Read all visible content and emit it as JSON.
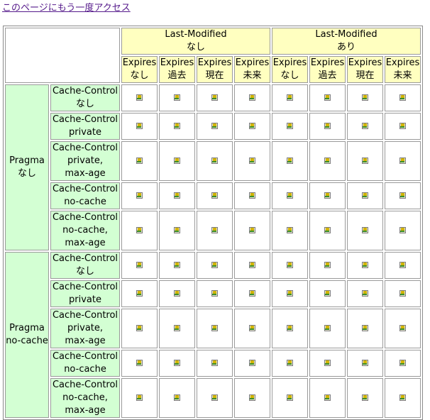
{
  "top_link": "このページにもう一度アクセス",
  "header": {
    "last_modified_groups": [
      {
        "line1": "Last-Modified",
        "line2": "なし"
      },
      {
        "line1": "Last-Modified",
        "line2": "あり"
      }
    ],
    "expires_columns": [
      {
        "line1": "Expires",
        "line2": "なし"
      },
      {
        "line1": "Expires",
        "line2": "過去"
      },
      {
        "line1": "Expires",
        "line2": "現在"
      },
      {
        "line1": "Expires",
        "line2": "未来"
      },
      {
        "line1": "Expires",
        "line2": "なし"
      },
      {
        "line1": "Expires",
        "line2": "過去"
      },
      {
        "line1": "Expires",
        "line2": "現在"
      },
      {
        "line1": "Expires",
        "line2": "未来"
      }
    ]
  },
  "pragma_groups": [
    {
      "label": [
        "Pragma",
        "なし"
      ],
      "cache_control_rows": [
        [
          "Cache-Control",
          "なし"
        ],
        [
          "Cache-Control",
          "private"
        ],
        [
          "Cache-Control",
          "private,",
          "max-age"
        ],
        [
          "Cache-Control",
          "no-cache"
        ],
        [
          "Cache-Control",
          "no-cache,",
          "max-age"
        ]
      ]
    },
    {
      "label": [
        "Pragma",
        "no-cache"
      ],
      "cache_control_rows": [
        [
          "Cache-Control",
          "なし"
        ],
        [
          "Cache-Control",
          "private"
        ],
        [
          "Cache-Control",
          "private,",
          "max-age"
        ],
        [
          "Cache-Control",
          "no-cache"
        ],
        [
          "Cache-Control",
          "no-cache,",
          "max-age"
        ]
      ]
    }
  ],
  "cell_icon": "cached-image-icon",
  "colors": {
    "header_yellow": "#ffffc0",
    "row_green": "#d3ffd3",
    "link": "#551a8b"
  }
}
